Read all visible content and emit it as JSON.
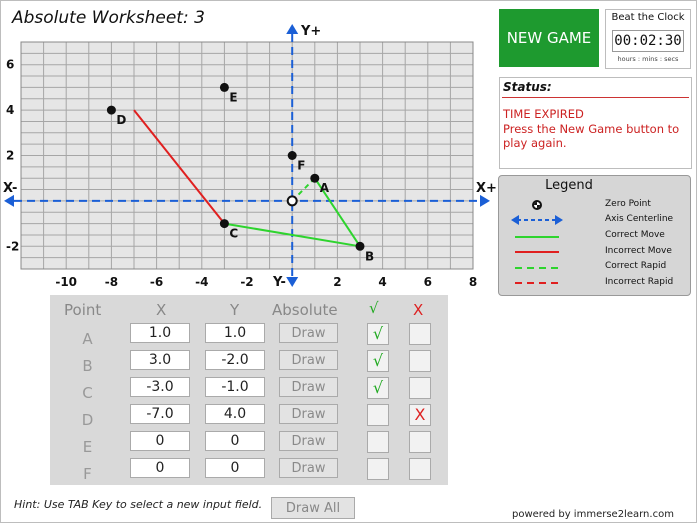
{
  "title": "Absolute Worksheet: 3",
  "axes": {
    "y_plus": "Y+",
    "y_minus": "Y-",
    "x_minus": "X-",
    "x_plus": "X+"
  },
  "graph": {
    "x_range": [
      -12,
      8
    ],
    "y_range": [
      -3,
      7
    ],
    "x_tick_labels": [
      -10,
      -8,
      -6,
      -4,
      -2,
      2,
      4,
      6,
      8
    ],
    "y_tick_labels": [
      -2,
      2,
      4,
      6
    ],
    "points": [
      {
        "name": "A",
        "x": 1,
        "y": 1
      },
      {
        "name": "B",
        "x": 3,
        "y": -2
      },
      {
        "name": "C",
        "x": -3,
        "y": -1
      },
      {
        "name": "D",
        "x": -8,
        "y": 4
      },
      {
        "name": "E",
        "x": -3,
        "y": 5
      },
      {
        "name": "F",
        "x": 0,
        "y": 2
      }
    ],
    "moves": [
      {
        "kind": "correct-rapid",
        "from": [
          0,
          0
        ],
        "to": [
          1,
          1
        ]
      },
      {
        "kind": "correct-move",
        "from": [
          1,
          1
        ],
        "to": [
          3,
          -2
        ]
      },
      {
        "kind": "correct-move",
        "from": [
          3,
          -2
        ],
        "to": [
          -3,
          -1
        ]
      },
      {
        "kind": "incorrect-move",
        "from": [
          -3,
          -1
        ],
        "to": [
          -7,
          4
        ]
      }
    ],
    "colors": {
      "axis": "#1b5fd6",
      "correct": "#2ed42e",
      "incorrect": "#e02020",
      "grid": "#a6a6a6",
      "bg": "#e6e6e6"
    }
  },
  "new_game": {
    "label": "NEW GAME",
    "color": "#1e9a2f"
  },
  "clock": {
    "label": "Beat the Clock",
    "time": "00:02:30",
    "units": "hours : mins : secs"
  },
  "status": {
    "heading": "Status:",
    "line1": "TIME EXPIRED",
    "line2": "Press the New Game button to play again."
  },
  "legend": {
    "title": "Legend",
    "items": [
      {
        "label": "Zero Point",
        "icon": "zero-point-icon"
      },
      {
        "label": "Axis Centerline",
        "icon": "axis-centerline-icon"
      },
      {
        "label": "Correct Move",
        "icon": "correct-move-line"
      },
      {
        "label": "Incorrect Move",
        "icon": "incorrect-move-line"
      },
      {
        "label": "Correct Rapid",
        "icon": "correct-rapid-line"
      },
      {
        "label": "Incorrect Rapid",
        "icon": "incorrect-rapid-line"
      }
    ]
  },
  "table": {
    "headers": {
      "point": "Point",
      "x": "X",
      "y": "Y",
      "absolute": "Absolute",
      "check": "√",
      "cross": "X"
    },
    "draw_label": "Draw",
    "rows": [
      {
        "point": "A",
        "x": "1.0",
        "y": "1.0",
        "ok": "√",
        "bad": ""
      },
      {
        "point": "B",
        "x": "3.0",
        "y": "-2.0",
        "ok": "√",
        "bad": ""
      },
      {
        "point": "C",
        "x": "-3.0",
        "y": "-1.0",
        "ok": "√",
        "bad": ""
      },
      {
        "point": "D",
        "x": "-7.0",
        "y": "4.0",
        "ok": "",
        "bad": "X"
      },
      {
        "point": "E",
        "x": "0",
        "y": "0",
        "ok": "",
        "bad": ""
      },
      {
        "point": "F",
        "x": "0",
        "y": "0",
        "ok": "",
        "bad": ""
      }
    ]
  },
  "hint": "Hint: Use TAB Key to select a new input field.",
  "draw_all": "Draw All",
  "powered_by": "powered by immerse2learn.com"
}
